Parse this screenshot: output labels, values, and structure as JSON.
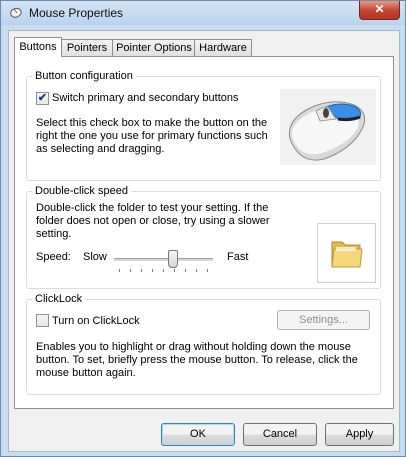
{
  "window": {
    "title": "Mouse Properties",
    "close_label": "✕",
    "app_icon": "mouse-icon"
  },
  "tabs": [
    {
      "label": "Buttons",
      "active": true
    },
    {
      "label": "Pointers",
      "active": false
    },
    {
      "label": "Pointer Options",
      "active": false
    },
    {
      "label": "Hardware",
      "active": false
    }
  ],
  "button_configuration": {
    "title": "Button configuration",
    "checkbox_label": "Switch primary and secondary buttons",
    "checked": true,
    "description_lines": [
      "Select this check box to make the button on the",
      "right the one you use for primary functions such",
      "as selecting and dragging."
    ],
    "image_icon": "mouse-icon"
  },
  "double_click": {
    "title": "Double-click speed",
    "description_lines": [
      "Double-click the folder to test your setting. If the",
      "folder does not open or close, try using a slower",
      "setting."
    ],
    "speed_label": "Speed:",
    "slow_label": "Slow",
    "fast_label": "Fast",
    "speed_level": 0.6,
    "folder_icon": "folder-icon"
  },
  "clicklock": {
    "title": "ClickLock",
    "checkbox_label": "Turn on ClickLock",
    "checked": false,
    "settings_label": "Settings...",
    "description_lines": [
      "Enables you to highlight or drag without holding down the mouse",
      "button. To set, briefly press the mouse button. To release, click the",
      "mouse button again."
    ]
  },
  "footer": {
    "ok_label": "OK",
    "cancel_label": "Cancel",
    "apply_label": "Apply"
  },
  "colors": {
    "accent": "#3c7fb1",
    "check": "#1c3e87",
    "mouse_accent": "#3a8ee6"
  }
}
